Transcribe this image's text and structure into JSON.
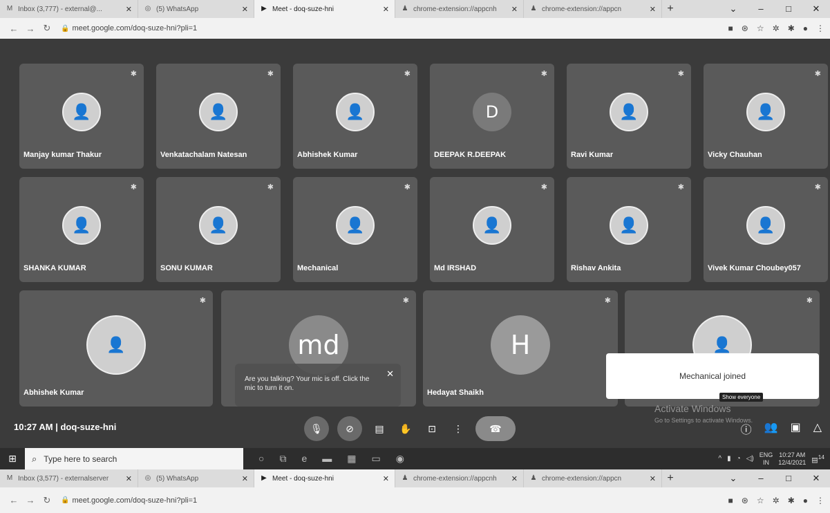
{
  "browser": {
    "tabs": [
      {
        "icon": "gmail-icon",
        "title": "Inbox (3,777) - external@...",
        "active": false
      },
      {
        "icon": "whatsapp-icon",
        "title": "(5) WhatsApp",
        "active": false
      },
      {
        "icon": "meet-icon",
        "title": "Meet - doq-suze-hni",
        "active": true
      },
      {
        "icon": "extension-icon",
        "title": "chrome-extension://appcnh",
        "active": false
      },
      {
        "icon": "extension-icon",
        "title": "chrome-extension://appcn",
        "active": false
      }
    ],
    "tabs_bottom": [
      {
        "icon": "gmail-icon",
        "title": "Inbox (3,577) - externalserver",
        "active": false
      },
      {
        "icon": "whatsapp-icon",
        "title": "(5) WhatsApp",
        "active": false
      },
      {
        "icon": "meet-icon",
        "title": "Meet - doq-suze-hni",
        "active": true
      },
      {
        "icon": "extension-icon",
        "title": "chrome-extension://appcnh",
        "active": false
      },
      {
        "icon": "extension-icon",
        "title": "chrome-extension://appcn",
        "active": false
      }
    ],
    "url": "meet.google.com/doq-suze-hni?pli=1",
    "url_bottom": "meet.google.com/doq-suze-hni?pli=1"
  },
  "meet": {
    "participants": [
      {
        "name": "Manjay kumar Thakur",
        "type": "photo"
      },
      {
        "name": "Venkatachalam Natesan",
        "type": "photo"
      },
      {
        "name": "Abhishek Kumar",
        "type": "photo"
      },
      {
        "name": "DEEPAK R.DEEPAK",
        "type": "initial",
        "initial": "D",
        "color": "#7a7a7a"
      },
      {
        "name": "Ravi Kumar",
        "type": "photo"
      },
      {
        "name": "Vicky Chauhan",
        "type": "photo"
      },
      {
        "name": "SHANKA KUMAR",
        "type": "photo"
      },
      {
        "name": "SONU KUMAR",
        "type": "photo"
      },
      {
        "name": "Mechanical",
        "type": "photo"
      },
      {
        "name": "Md IRSHAD",
        "type": "photo"
      },
      {
        "name": "Rishav Ankita",
        "type": "photo"
      },
      {
        "name": "Vivek Kumar Choubey057",
        "type": "photo"
      },
      {
        "name": "Abhishek Kumar",
        "type": "photo"
      },
      {
        "name": "",
        "type": "initial",
        "initial": "md",
        "color": "#8a8a8a"
      },
      {
        "name": "Hedayat Shaikh",
        "type": "initial",
        "initial": "H",
        "color": "#9a9a9a"
      },
      {
        "name": "",
        "type": "photo"
      }
    ],
    "mic_tooltip": "Are you talking? Your mic is off. Click the mic to turn it on.",
    "toast": "Mechanical joined",
    "show_everyone": "Show everyone",
    "activate_title": "Activate Windows",
    "activate_sub": "Go to Settings to activate Windows.",
    "time": "10:27 AM",
    "meeting_code": "doq-suze-hni"
  },
  "taskbar": {
    "search_placeholder": "Type here to search",
    "lang": "ENG",
    "region": "IN",
    "clock_time": "10:27 AM",
    "clock_date": "12/4/2021",
    "notif_count": "14"
  }
}
